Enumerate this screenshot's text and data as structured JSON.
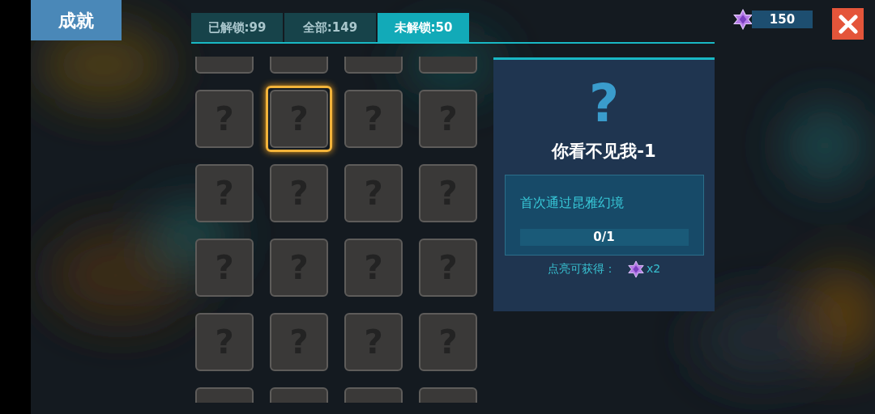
{
  "title": "成就",
  "tabs": [
    {
      "label": "已解锁:99",
      "selected": false
    },
    {
      "label": "全部:149",
      "selected": false
    },
    {
      "label": "未解锁:50",
      "selected": true
    }
  ],
  "currency": {
    "amount": "150"
  },
  "tile_rows": [
    [
      {
        "kind": "partial",
        "selected": false
      },
      {
        "kind": "partial",
        "selected": false
      },
      {
        "kind": "partial",
        "selected": false
      },
      {
        "kind": "partial",
        "selected": false
      }
    ],
    [
      {
        "kind": "locked",
        "symbol": "?",
        "selected": false
      },
      {
        "kind": "locked",
        "symbol": "?",
        "selected": true
      },
      {
        "kind": "locked",
        "symbol": "?",
        "selected": false
      },
      {
        "kind": "locked",
        "symbol": "?",
        "selected": false
      }
    ],
    [
      {
        "kind": "locked",
        "symbol": "?",
        "selected": false
      },
      {
        "kind": "locked",
        "symbol": "?",
        "selected": false
      },
      {
        "kind": "locked",
        "symbol": "?",
        "selected": false
      },
      {
        "kind": "locked",
        "symbol": "?",
        "selected": false
      }
    ],
    [
      {
        "kind": "locked",
        "symbol": "?",
        "selected": false
      },
      {
        "kind": "locked",
        "symbol": "?",
        "selected": false
      },
      {
        "kind": "locked",
        "symbol": "?",
        "selected": false
      },
      {
        "kind": "locked",
        "symbol": "?",
        "selected": false
      }
    ],
    [
      {
        "kind": "locked",
        "symbol": "?",
        "selected": false
      },
      {
        "kind": "locked",
        "symbol": "?",
        "selected": false
      },
      {
        "kind": "locked",
        "symbol": "?",
        "selected": false
      },
      {
        "kind": "locked",
        "symbol": "?",
        "selected": false
      }
    ],
    [
      {
        "kind": "partial",
        "selected": false
      },
      {
        "kind": "partial",
        "selected": false
      },
      {
        "kind": "partial",
        "selected": false
      },
      {
        "kind": "partial",
        "selected": false
      }
    ]
  ],
  "detail": {
    "symbol": "?",
    "name": "你看不见我-1",
    "description": "首次通过昆雅幻境",
    "progress": {
      "level": 0,
      "reading": "0/1"
    },
    "reward_label": "点亮可获得：",
    "reward_count": "x2"
  }
}
